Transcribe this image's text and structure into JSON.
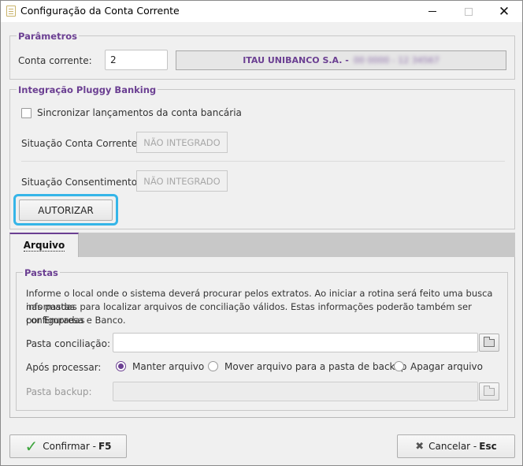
{
  "window": {
    "title": "Configuração da Conta Corrente"
  },
  "parametros": {
    "legend": "Parâmetros",
    "conta_label": "Conta corrente:",
    "conta_value": "2",
    "bank_name": "ITAU UNIBANCO S.A. -",
    "bank_detail": "00 0000 - 12 34567"
  },
  "pluggy": {
    "legend": "Integração Pluggy Banking",
    "sync_label": "Sincronizar lançamentos da conta bancária",
    "situacao_conta_label": "Situação Conta Corrente:",
    "situacao_conta_value": "NÃO INTEGRADO",
    "situacao_consent_label": "Situação Consentimento:",
    "situacao_consent_value": "NÃO INTEGRADO",
    "authorize_label": "AUTORIZAR"
  },
  "tabs": [
    {
      "label": "Arquivo"
    }
  ],
  "pastas": {
    "legend": "Pastas",
    "info_line1": "Informe o local onde o sistema deverá procurar pelos extratos. Ao iniciar a rotina será feito uma busca nas pastas",
    "info_line2": "informadas para localizar arquivos de conciliação válidos. Estas informações poderão também ser configuradas",
    "info_line3": "por Empresa e Banco.",
    "conciliacao_label": "Pasta conciliação:",
    "conciliacao_value": "",
    "apos_label": "Após processar:",
    "options": [
      {
        "label": "Manter arquivo",
        "selected": true
      },
      {
        "label": "Mover arquivo para a pasta de backup",
        "selected": false
      },
      {
        "label": "Apagar arquivo",
        "selected": false
      }
    ],
    "backup_label": "Pasta backup:",
    "backup_value": ""
  },
  "footer": {
    "confirm_label": "Confirmar - ",
    "confirm_key": "F5",
    "cancel_label": "Cancelar - ",
    "cancel_key": "Esc"
  },
  "colors": {
    "accent": "#6b3f92",
    "focus": "#35b5e8",
    "confirm": "#3ca43c"
  }
}
